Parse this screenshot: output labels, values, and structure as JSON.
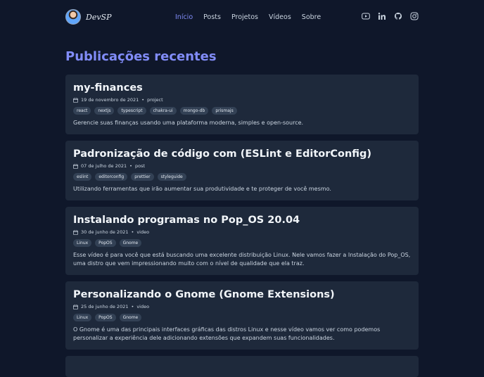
{
  "brand": {
    "name": "DevSP"
  },
  "nav": {
    "items": [
      "Início",
      "Posts",
      "Projetos",
      "Vídeos",
      "Sobre"
    ],
    "active": "Início"
  },
  "social": [
    "youtube-icon",
    "linkedin-icon",
    "github-icon",
    "instagram-icon"
  ],
  "page": {
    "heading": "Publicações recentes"
  },
  "posts": [
    {
      "title": "my-finances",
      "date": "19 de novembro de 2021",
      "type": "project",
      "tags": [
        "react",
        "nextjs",
        "typescript",
        "chakra-ui",
        "mongo-db",
        "prismajs"
      ],
      "description": "Gerencie suas finanças usando uma plataforma moderna, simples e open-source."
    },
    {
      "title": "Padronização de código com (ESLint e EditorConfig)",
      "date": "07 de julho de 2021",
      "type": "post",
      "tags": [
        "eslint",
        "editorconfig",
        "prettier",
        "styleguide"
      ],
      "description": "Utilizando ferramentas que irão aumentar sua produtividade e te proteger de você mesmo."
    },
    {
      "title": "Instalando programas no Pop_OS 20.04",
      "date": "30 de junho de 2021",
      "type": "video",
      "tags": [
        "Linux",
        "PopOS",
        "Gnome"
      ],
      "description": "Esse vídeo é para você que está buscando uma excelente distribuição Linux. Nele vamos fazer a Instalação do Pop_OS, uma distro que vem impressionando muito com o nível de qualidade que ela traz."
    },
    {
      "title": "Personalizando o Gnome (Gnome Extensions)",
      "date": "25 de junho de 2021",
      "type": "video",
      "tags": [
        "Linux",
        "PopOS",
        "Gnome"
      ],
      "description": "O Gnome é uma das principais interfaces gráficas das distros Linux e nesse vídeo vamos ver como podemos personalizar a experiência dele adicionando extensões que expandem suas funcionalidades."
    }
  ]
}
